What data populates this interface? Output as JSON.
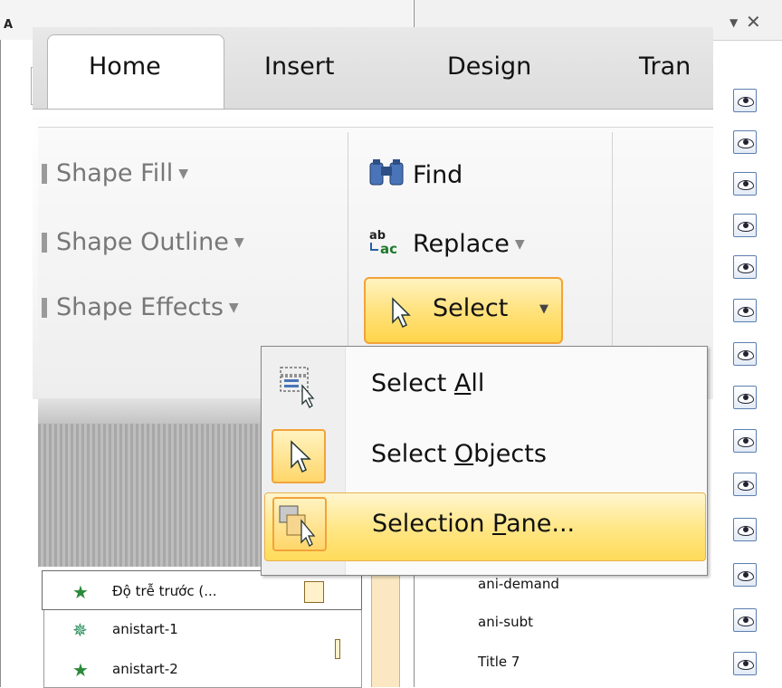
{
  "left_pane": {
    "title_fragment": "A"
  },
  "right_pane": {
    "dropdown_arrow": "▼",
    "close": "✕"
  },
  "tabs": [
    {
      "label": "Home"
    },
    {
      "label": "Insert"
    },
    {
      "label": "Design"
    },
    {
      "label": "Tran"
    }
  ],
  "drawing_group": {
    "shape_fill": "Shape Fill",
    "shape_outline": "Shape Outline",
    "shape_effects": "Shape Effects",
    "caret": "▼"
  },
  "editing_group": {
    "find": "Find",
    "replace": "Replace",
    "select": "Select",
    "caret": "▼"
  },
  "select_menu": {
    "select_all_pre": "Select ",
    "select_all_acc": "A",
    "select_all_post": "ll",
    "select_objects_pre": "Select ",
    "select_objects_acc": "O",
    "select_objects_post": "bjects",
    "selection_pane_pre": "Selection ",
    "selection_pane_acc": "P",
    "selection_pane_post": "ane..."
  },
  "animation_list": [
    {
      "label": "Độ trễ trước (..."
    },
    {
      "label": "anistart-1"
    },
    {
      "label": "anistart-2"
    }
  ],
  "selection_list": [
    {
      "label": "ani-demand"
    },
    {
      "label": "ani-subt"
    },
    {
      "label": "Title 7"
    }
  ],
  "colors": {
    "accent_orange": "#f2a33a",
    "highlight_yellow": "#ffe27d",
    "eye_border": "#5c7fb0"
  }
}
